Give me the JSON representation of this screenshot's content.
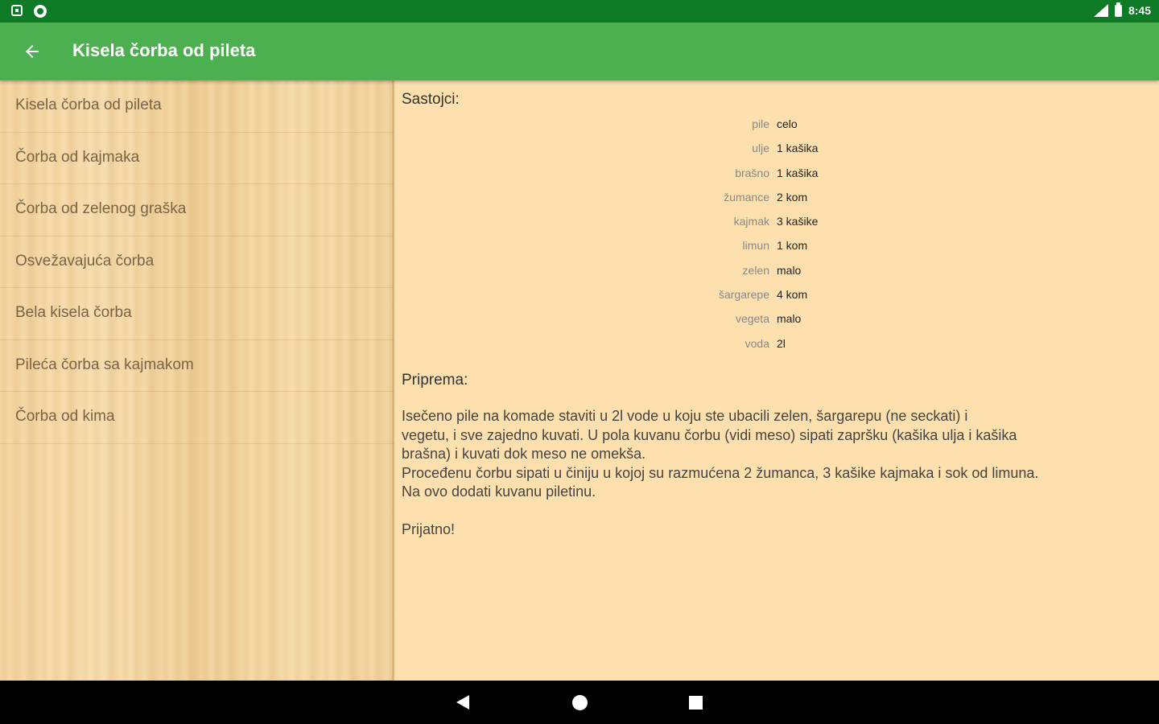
{
  "status_bar": {
    "time": "8:45",
    "icons": [
      "notification-square-icon",
      "notification-circle-icon",
      "signal-icon",
      "battery-icon"
    ]
  },
  "app_bar": {
    "title": "Kisela čorba od pileta",
    "back_icon": "arrow-left-icon"
  },
  "sidebar": {
    "items": [
      {
        "label": "Kisela čorba od pileta"
      },
      {
        "label": "Čorba od kajmaka"
      },
      {
        "label": "Čorba od zelenog graška"
      },
      {
        "label": "Osvežavajuća čorba"
      },
      {
        "label": "Bela kisela čorba"
      },
      {
        "label": "Pileća čorba sa kajmakom"
      },
      {
        "label": "Čorba od kima"
      }
    ]
  },
  "recipe": {
    "ingredients_heading": "Sastojci:",
    "ingredients": [
      {
        "name": "pile",
        "amount": "celo"
      },
      {
        "name": "ulje",
        "amount": "1 kašika"
      },
      {
        "name": "brašno",
        "amount": "1 kašika"
      },
      {
        "name": "žumance",
        "amount": "2 kom"
      },
      {
        "name": "kajmak",
        "amount": "3 kašike"
      },
      {
        "name": "limun",
        "amount": "1 kom"
      },
      {
        "name": "zelen",
        "amount": "malo"
      },
      {
        "name": "šargarepe",
        "amount": "4 kom"
      },
      {
        "name": "vegeta",
        "amount": "malo"
      },
      {
        "name": "voda",
        "amount": "2l"
      }
    ],
    "preparation_heading": "Priprema:",
    "preparation_text": "Isečeno pile na komade staviti u 2l vode u koju ste ubacili zelen, šargarepu (ne seckati) i\nvegetu, i sve zajedno kuvati. U pola kuvanu čorbu (vidi meso) sipati zapršku (kašika ulja i kašika\nbrašna) i kuvati dok meso ne omekša.\nProceđenu čorbu sipati u činiju u kojoj su razmućena 2 žumanca, 3 kašike kajmaka i sok od limuna.\nNa ovo dodati kuvanu piletinu.\n\nPrijatno!"
  },
  "nav_bar": {
    "icons": [
      "back-triangle-icon",
      "home-circle-icon",
      "recents-square-icon"
    ]
  },
  "colors": {
    "status_bar": "#0f7a25",
    "app_bar": "#4caf50",
    "content_bg": "#fde0ae",
    "sidebar_text": "#7a6448"
  }
}
